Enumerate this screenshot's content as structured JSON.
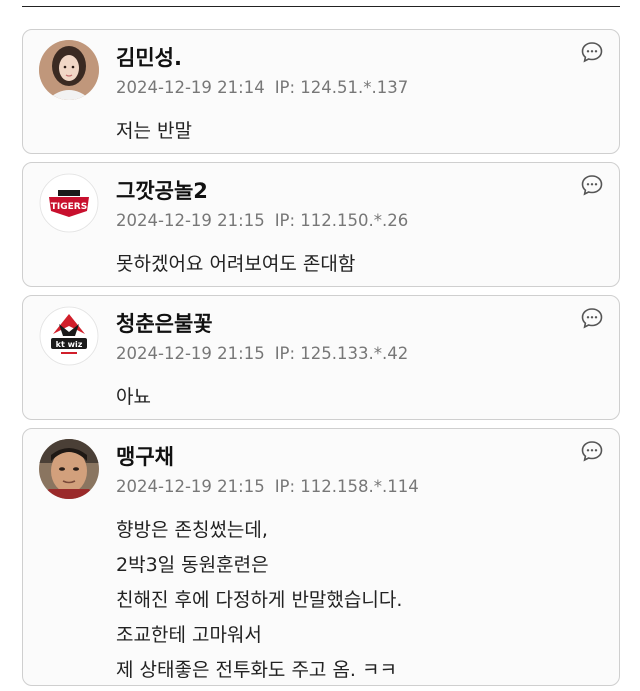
{
  "comments": [
    {
      "nickname": "김민성.",
      "datetime": "2024-12-19 21:14",
      "ip": "IP: 124.51.*.137",
      "lines": [
        "저는 반말"
      ],
      "avatar_icon": "user-photo-avatar"
    },
    {
      "nickname": "그깟공놀2",
      "datetime": "2024-12-19 21:15",
      "ip": "IP: 112.150.*.26",
      "lines": [
        "못하겠어요 어려보여도 존대함"
      ],
      "avatar_icon": "tigers-logo-avatar",
      "avatar_text": "TIGERS"
    },
    {
      "nickname": "청춘은불꽃",
      "datetime": "2024-12-19 21:15",
      "ip": "IP: 125.133.*.42",
      "lines": [
        "아뇨"
      ],
      "avatar_icon": "kt-wiz-logo-avatar",
      "avatar_text": "kt wiz"
    },
    {
      "nickname": "맹구채",
      "datetime": "2024-12-19 21:15",
      "ip": "IP: 112.158.*.114",
      "lines": [
        "향방은 존칭썼는데,",
        "2박3일 동원훈련은",
        "친해진 후에 다정하게 반말했습니다.",
        "조교한테 고마워서",
        "제 상태좋은 전투화도 주고 옴. ㅋㅋ"
      ],
      "avatar_icon": "user-photo-avatar"
    }
  ],
  "colors": {
    "card_border": "#cfcfcf",
    "card_bg": "#fbfbfb",
    "meta_text": "#777777",
    "tigers_red": "#c8102e"
  }
}
